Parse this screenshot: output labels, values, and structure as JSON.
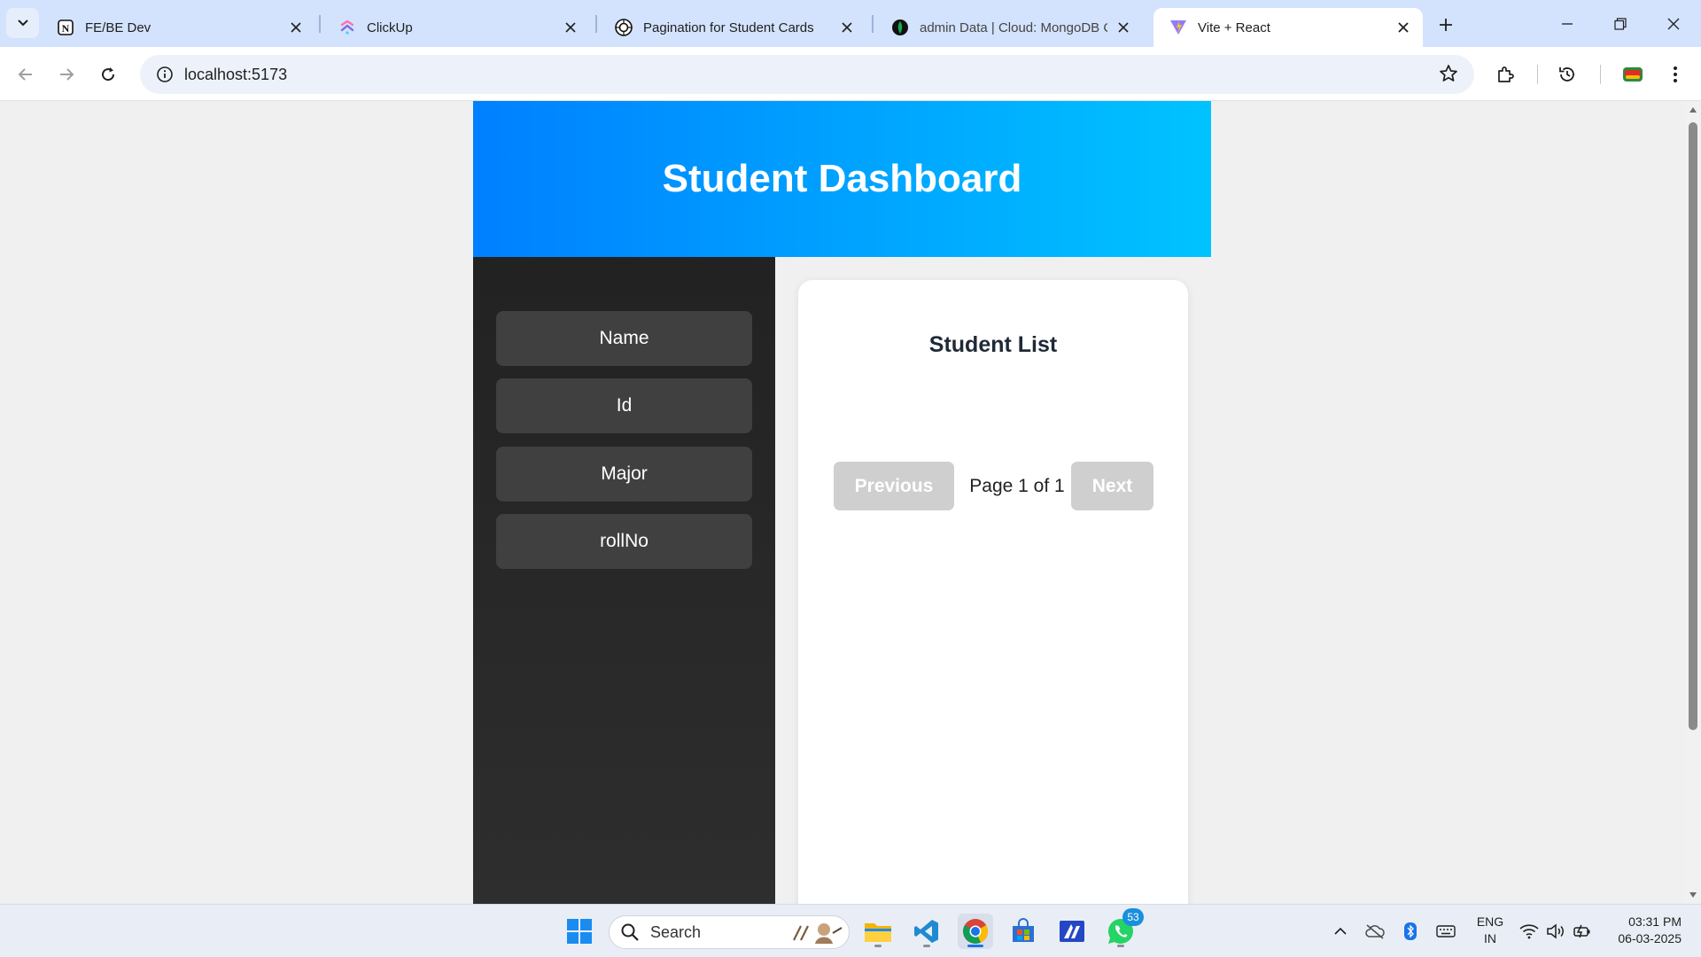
{
  "browser": {
    "tabs": [
      {
        "title": "FE/BE Dev",
        "icon": "notion-icon"
      },
      {
        "title": "ClickUp",
        "icon": "clickup-icon"
      },
      {
        "title": "Pagination for Student Cards",
        "icon": "chatgpt-icon"
      },
      {
        "title": "admin Data | Cloud: MongoDB Clo",
        "icon": "mongodb-icon"
      },
      {
        "title": "Vite + React",
        "icon": "vite-icon",
        "active": true
      }
    ],
    "url": "localhost:5173"
  },
  "page": {
    "header_title": "Student Dashboard",
    "sidebar_items": [
      "Name",
      "Id",
      "Major",
      "rollNo"
    ],
    "list_title": "Student List",
    "pagination": {
      "previous_label": "Previous",
      "page_info": "Page 1 of 1",
      "next_label": "Next"
    }
  },
  "taskbar": {
    "search_label": "Search",
    "apps": [
      "file-explorer-icon",
      "vscode-icon",
      "chrome-icon",
      "microsoft-store-icon",
      "azure-data-studio-icon",
      "whatsapp-icon"
    ],
    "whatsapp_badge": "53",
    "language": "ENG",
    "region": "IN",
    "time": "03:31 PM",
    "date": "06-03-2025"
  },
  "colors": {
    "header_gradient_start": "#0080ff",
    "header_gradient_end": "#00c3ff",
    "sidebar_bg": "#2a2a2a",
    "sidebar_button": "#404040",
    "disabled_button": "#cfcfcf"
  }
}
